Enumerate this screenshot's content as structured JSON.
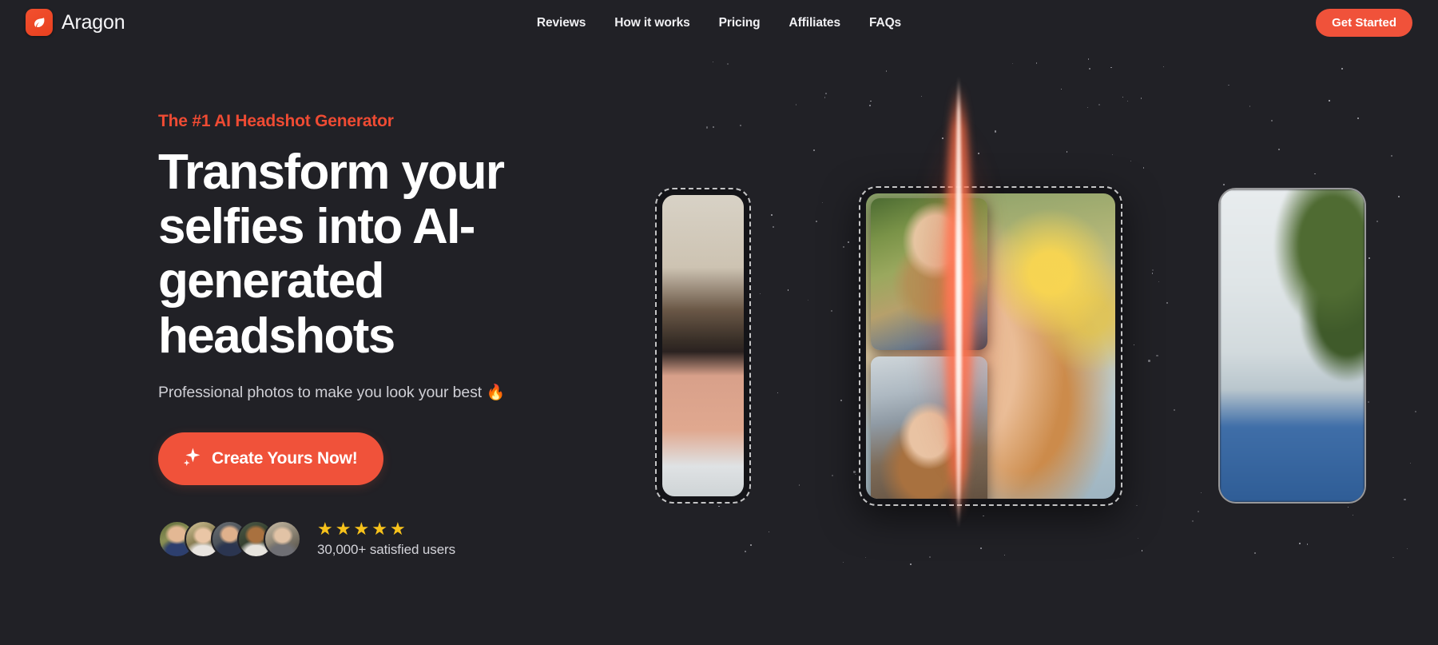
{
  "brand": {
    "name": "Aragon",
    "logo_icon": "flame-leaf-icon",
    "accent_color": "#f0523a"
  },
  "nav": {
    "links": [
      {
        "label": "Reviews"
      },
      {
        "label": "How it works"
      },
      {
        "label": "Pricing"
      },
      {
        "label": "Affiliates"
      },
      {
        "label": "FAQs"
      }
    ],
    "cta_label": "Get Started"
  },
  "hero": {
    "eyebrow": "The #1 AI Headshot Generator",
    "headline": "Transform your selfies into AI-generated headshots",
    "subhead": "Professional photos to make you look your best",
    "subhead_emoji": "🔥",
    "cta_label": "Create Yours Now!",
    "cta_icon": "sparkle-icon"
  },
  "social_proof": {
    "rating_stars": 5,
    "star_glyph": "★",
    "star_color": "#f7c21b",
    "users_text": "30,000+ satisfied users",
    "avatar_count": 5,
    "avatars": [
      {
        "name": "avatar-1"
      },
      {
        "name": "avatar-2"
      },
      {
        "name": "avatar-3"
      },
      {
        "name": "avatar-4"
      },
      {
        "name": "avatar-5"
      }
    ]
  },
  "showcase": {
    "cards": [
      {
        "name": "card-left",
        "style": "dashed"
      },
      {
        "name": "card-center",
        "style": "dashed"
      },
      {
        "name": "card-right",
        "style": "solid"
      }
    ],
    "beam_color": "#ff6844",
    "thumbnails": 2
  },
  "theme": {
    "background": "#212126",
    "text_primary": "#ffffff",
    "text_secondary": "#cfcfd5"
  }
}
